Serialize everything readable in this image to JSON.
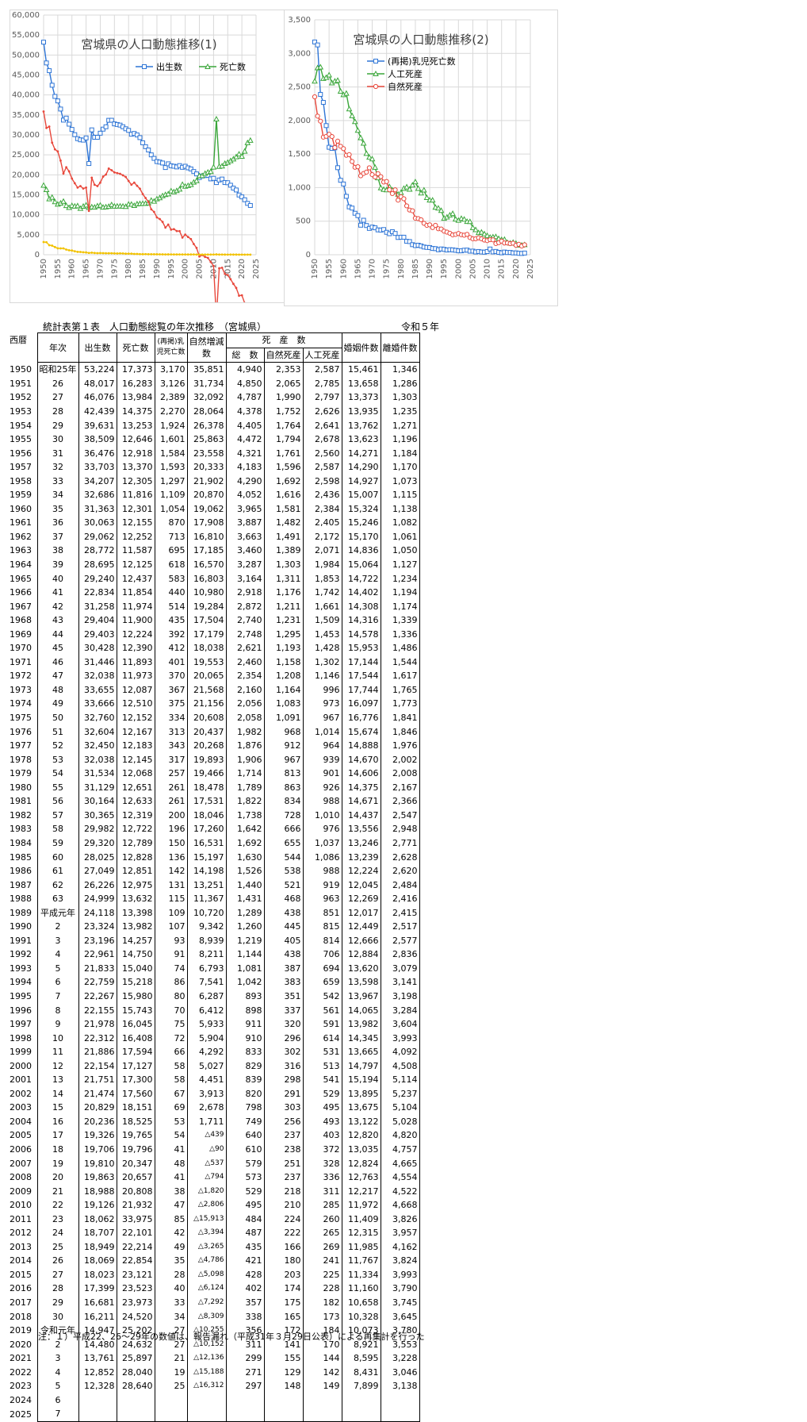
{
  "chart_data": [
    {
      "type": "line",
      "title": "宮城県の人口動態推移(1)",
      "ylim": [
        0,
        60000
      ],
      "yticks": [
        "0",
        "5,000",
        "10,000",
        "15,000",
        "20,000",
        "25,000",
        "30,000",
        "35,000",
        "40,000",
        "45,000",
        "50,000",
        "55,000",
        "60,000"
      ],
      "xlim": [
        1950,
        2025
      ],
      "xticks": [
        "1950",
        "1955",
        "1960",
        "1965",
        "1970",
        "1975",
        "1980",
        "1985",
        "1990",
        "1995",
        "2000",
        "2005",
        "2010",
        "2015",
        "2020",
        "2025"
      ],
      "grid": true,
      "legend": "top-right",
      "series": [
        {
          "name": "出生数",
          "color": "#2e75d6",
          "marker": "square",
          "field": "births"
        },
        {
          "name": "死亡数",
          "color": "#3aa63a",
          "marker": "triangle",
          "field": "deaths"
        },
        {
          "name": "",
          "color": "#e8483c",
          "marker": "none",
          "field": "natural"
        },
        {
          "name": "",
          "color": "#f2c200",
          "marker": "none",
          "field": "infant"
        }
      ]
    },
    {
      "type": "line",
      "title": "宮城県の人口動態推移(2)",
      "ylim": [
        0,
        3500
      ],
      "yticks": [
        "0",
        "500",
        "1,000",
        "1,500",
        "2,000",
        "2,500",
        "3,000",
        "3,500"
      ],
      "xlim": [
        1950,
        2025
      ],
      "xticks": [
        "1950",
        "1955",
        "1960",
        "1965",
        "1970",
        "1975",
        "1980",
        "1985",
        "1990",
        "1995",
        "2000",
        "2005",
        "2010",
        "2015",
        "2020",
        "2025"
      ],
      "grid": true,
      "legend": "top-right",
      "series": [
        {
          "name": "(再掲)乳児死亡数",
          "color": "#2e75d6",
          "marker": "square",
          "field": "infant"
        },
        {
          "name": "人工死産",
          "color": "#3aa63a",
          "marker": "triangle",
          "field": "artificial"
        },
        {
          "name": "自然死産",
          "color": "#e8483c",
          "marker": "circle",
          "field": "naturalStill"
        }
      ]
    }
  ],
  "table": {
    "title": "統計表第１表　人口動態総覧の年次推移　（宮城県）",
    "edition": "令和５年",
    "headers": {
      "year": "西暦",
      "era": "年次",
      "births": "出生数",
      "deaths": "死亡数",
      "infant_line1": "(再掲)乳",
      "infant_line2": "児死亡数",
      "natural_line1": "自然増減",
      "natural_line2": "数",
      "stillbirth": "死　産　数",
      "still_total": "総　数",
      "still_natural": "自然死産",
      "still_artificial": "人工死産",
      "marriages": "婚姻件数",
      "divorces": "離婚件数"
    },
    "rows": [
      [
        "1950",
        "昭和25年",
        "53,224",
        "17,373",
        "3,170",
        "35,851",
        "4,940",
        "2,353",
        "2,587",
        "15,461",
        "1,346"
      ],
      [
        "1951",
        "26",
        "48,017",
        "16,283",
        "3,126",
        "31,734",
        "4,850",
        "2,065",
        "2,785",
        "13,658",
        "1,286"
      ],
      [
        "1952",
        "27",
        "46,076",
        "13,984",
        "2,389",
        "32,092",
        "4,787",
        "1,990",
        "2,797",
        "13,373",
        "1,303"
      ],
      [
        "1953",
        "28",
        "42,439",
        "14,375",
        "2,270",
        "28,064",
        "4,378",
        "1,752",
        "2,626",
        "13,935",
        "1,235"
      ],
      [
        "1954",
        "29",
        "39,631",
        "13,253",
        "1,924",
        "26,378",
        "4,405",
        "1,764",
        "2,641",
        "13,762",
        "1,271"
      ],
      [
        "1955",
        "30",
        "38,509",
        "12,646",
        "1,601",
        "25,863",
        "4,472",
        "1,794",
        "2,678",
        "13,623",
        "1,196"
      ],
      [
        "1956",
        "31",
        "36,476",
        "12,918",
        "1,584",
        "23,558",
        "4,321",
        "1,761",
        "2,560",
        "14,271",
        "1,184"
      ],
      [
        "1957",
        "32",
        "33,703",
        "13,370",
        "1,593",
        "20,333",
        "4,183",
        "1,596",
        "2,587",
        "14,290",
        "1,170"
      ],
      [
        "1958",
        "33",
        "34,207",
        "12,305",
        "1,297",
        "21,902",
        "4,290",
        "1,692",
        "2,598",
        "14,927",
        "1,073"
      ],
      [
        "1959",
        "34",
        "32,686",
        "11,816",
        "1,109",
        "20,870",
        "4,052",
        "1,616",
        "2,436",
        "15,007",
        "1,115"
      ],
      [
        "1960",
        "35",
        "31,363",
        "12,301",
        "1,054",
        "19,062",
        "3,965",
        "1,581",
        "2,384",
        "15,324",
        "1,138"
      ],
      [
        "1961",
        "36",
        "30,063",
        "12,155",
        "870",
        "17,908",
        "3,887",
        "1,482",
        "2,405",
        "15,246",
        "1,082"
      ],
      [
        "1962",
        "37",
        "29,062",
        "12,252",
        "713",
        "16,810",
        "3,663",
        "1,491",
        "2,172",
        "15,170",
        "1,061"
      ],
      [
        "1963",
        "38",
        "28,772",
        "11,587",
        "695",
        "17,185",
        "3,460",
        "1,389",
        "2,071",
        "14,836",
        "1,050"
      ],
      [
        "1964",
        "39",
        "28,695",
        "12,125",
        "618",
        "16,570",
        "3,287",
        "1,303",
        "1,984",
        "15,064",
        "1,127"
      ],
      [
        "1965",
        "40",
        "29,240",
        "12,437",
        "583",
        "16,803",
        "3,164",
        "1,311",
        "1,853",
        "14,722",
        "1,234"
      ],
      [
        "1966",
        "41",
        "22,834",
        "11,854",
        "440",
        "10,980",
        "2,918",
        "1,176",
        "1,742",
        "14,402",
        "1,194"
      ],
      [
        "1967",
        "42",
        "31,258",
        "11,974",
        "514",
        "19,284",
        "2,872",
        "1,211",
        "1,661",
        "14,308",
        "1,174"
      ],
      [
        "1968",
        "43",
        "29,404",
        "11,900",
        "435",
        "17,504",
        "2,740",
        "1,231",
        "1,509",
        "14,316",
        "1,339"
      ],
      [
        "1969",
        "44",
        "29,403",
        "12,224",
        "392",
        "17,179",
        "2,748",
        "1,295",
        "1,453",
        "14,578",
        "1,336"
      ],
      [
        "1970",
        "45",
        "30,428",
        "12,390",
        "412",
        "18,038",
        "2,621",
        "1,193",
        "1,428",
        "15,953",
        "1,486"
      ],
      [
        "1971",
        "46",
        "31,446",
        "11,893",
        "401",
        "19,553",
        "2,460",
        "1,158",
        "1,302",
        "17,144",
        "1,544"
      ],
      [
        "1972",
        "47",
        "32,038",
        "11,973",
        "370",
        "20,065",
        "2,354",
        "1,208",
        "1,146",
        "17,544",
        "1,617"
      ],
      [
        "1973",
        "48",
        "33,655",
        "12,087",
        "367",
        "21,568",
        "2,160",
        "1,164",
        "996",
        "17,744",
        "1,765"
      ],
      [
        "1974",
        "49",
        "33,666",
        "12,510",
        "375",
        "21,156",
        "2,056",
        "1,083",
        "973",
        "16,097",
        "1,773"
      ],
      [
        "1975",
        "50",
        "32,760",
        "12,152",
        "334",
        "20,608",
        "2,058",
        "1,091",
        "967",
        "16,776",
        "1,841"
      ],
      [
        "1976",
        "51",
        "32,604",
        "12,167",
        "313",
        "20,437",
        "1,982",
        "968",
        "1,014",
        "15,674",
        "1,846"
      ],
      [
        "1977",
        "52",
        "32,450",
        "12,183",
        "343",
        "20,268",
        "1,876",
        "912",
        "964",
        "14,888",
        "1,976"
      ],
      [
        "1978",
        "53",
        "32,038",
        "12,145",
        "317",
        "19,893",
        "1,906",
        "967",
        "939",
        "14,670",
        "2,002"
      ],
      [
        "1979",
        "54",
        "31,534",
        "12,068",
        "257",
        "19,466",
        "1,714",
        "813",
        "901",
        "14,606",
        "2,008"
      ],
      [
        "1980",
        "55",
        "31,129",
        "12,651",
        "261",
        "18,478",
        "1,789",
        "863",
        "926",
        "14,375",
        "2,167"
      ],
      [
        "1981",
        "56",
        "30,164",
        "12,633",
        "261",
        "17,531",
        "1,822",
        "834",
        "988",
        "14,671",
        "2,366"
      ],
      [
        "1982",
        "57",
        "30,365",
        "12,319",
        "200",
        "18,046",
        "1,738",
        "728",
        "1,010",
        "14,437",
        "2,547"
      ],
      [
        "1983",
        "58",
        "29,982",
        "12,722",
        "196",
        "17,260",
        "1,642",
        "666",
        "976",
        "13,556",
        "2,948"
      ],
      [
        "1984",
        "59",
        "29,320",
        "12,789",
        "150",
        "16,531",
        "1,692",
        "655",
        "1,037",
        "13,246",
        "2,771"
      ],
      [
        "1985",
        "60",
        "28,025",
        "12,828",
        "136",
        "15,197",
        "1,630",
        "544",
        "1,086",
        "13,239",
        "2,628"
      ],
      [
        "1986",
        "61",
        "27,049",
        "12,851",
        "142",
        "14,198",
        "1,526",
        "538",
        "988",
        "12,224",
        "2,620"
      ],
      [
        "1987",
        "62",
        "26,226",
        "12,975",
        "131",
        "13,251",
        "1,440",
        "521",
        "919",
        "12,045",
        "2,484"
      ],
      [
        "1988",
        "63",
        "24,999",
        "13,632",
        "115",
        "11,367",
        "1,431",
        "468",
        "963",
        "12,269",
        "2,416"
      ],
      [
        "1989",
        "平成元年",
        "24,118",
        "13,398",
        "109",
        "10,720",
        "1,289",
        "438",
        "851",
        "12,017",
        "2,415"
      ],
      [
        "1990",
        "2",
        "23,324",
        "13,982",
        "107",
        "9,342",
        "1,260",
        "445",
        "815",
        "12,449",
        "2,517"
      ],
      [
        "1991",
        "3",
        "23,196",
        "14,257",
        "93",
        "8,939",
        "1,219",
        "405",
        "814",
        "12,666",
        "2,577"
      ],
      [
        "1992",
        "4",
        "22,961",
        "14,750",
        "91",
        "8,211",
        "1,144",
        "438",
        "706",
        "12,884",
        "2,836"
      ],
      [
        "1993",
        "5",
        "21,833",
        "15,040",
        "74",
        "6,793",
        "1,081",
        "387",
        "694",
        "13,620",
        "3,079"
      ],
      [
        "1994",
        "6",
        "22,759",
        "15,218",
        "86",
        "7,541",
        "1,042",
        "383",
        "659",
        "13,598",
        "3,141"
      ],
      [
        "1995",
        "7",
        "22,267",
        "15,980",
        "80",
        "6,287",
        "893",
        "351",
        "542",
        "13,967",
        "3,198"
      ],
      [
        "1996",
        "8",
        "22,155",
        "15,743",
        "70",
        "6,412",
        "898",
        "337",
        "561",
        "14,065",
        "3,284"
      ],
      [
        "1997",
        "9",
        "21,978",
        "16,045",
        "75",
        "5,933",
        "911",
        "320",
        "591",
        "13,982",
        "3,604"
      ],
      [
        "1998",
        "10",
        "22,312",
        "16,408",
        "72",
        "5,904",
        "910",
        "296",
        "614",
        "14,345",
        "3,993"
      ],
      [
        "1999",
        "11",
        "21,886",
        "17,594",
        "66",
        "4,292",
        "833",
        "302",
        "531",
        "13,665",
        "4,092"
      ],
      [
        "2000",
        "12",
        "22,154",
        "17,127",
        "58",
        "5,027",
        "829",
        "316",
        "513",
        "14,797",
        "4,508"
      ],
      [
        "2001",
        "13",
        "21,751",
        "17,300",
        "58",
        "4,451",
        "839",
        "298",
        "541",
        "15,194",
        "5,114"
      ],
      [
        "2002",
        "14",
        "21,474",
        "17,560",
        "67",
        "3,913",
        "820",
        "291",
        "529",
        "13,895",
        "5,237"
      ],
      [
        "2003",
        "15",
        "20,829",
        "18,151",
        "69",
        "2,678",
        "798",
        "303",
        "495",
        "13,675",
        "5,104"
      ],
      [
        "2004",
        "16",
        "20,236",
        "18,525",
        "53",
        "1,711",
        "749",
        "256",
        "493",
        "13,122",
        "5,028"
      ],
      [
        "2005",
        "17",
        "19,326",
        "19,765",
        "54",
        "△439",
        "640",
        "237",
        "403",
        "12,820",
        "4,820"
      ],
      [
        "2006",
        "18",
        "19,706",
        "19,796",
        "41",
        "△90",
        "610",
        "238",
        "372",
        "13,035",
        "4,757"
      ],
      [
        "2007",
        "19",
        "19,810",
        "20,347",
        "48",
        "△537",
        "579",
        "251",
        "328",
        "12,824",
        "4,665"
      ],
      [
        "2008",
        "20",
        "19,863",
        "20,657",
        "41",
        "△794",
        "573",
        "237",
        "336",
        "12,763",
        "4,554"
      ],
      [
        "2009",
        "21",
        "18,988",
        "20,808",
        "38",
        "△1,820",
        "529",
        "218",
        "311",
        "12,217",
        "4,522"
      ],
      [
        "2010",
        "22",
        "19,126",
        "21,932",
        "47",
        "△2,806",
        "495",
        "210",
        "285",
        "11,972",
        "4,668"
      ],
      [
        "2011",
        "23",
        "18,062",
        "33,975",
        "85",
        "△15,913",
        "484",
        "224",
        "260",
        "11,409",
        "3,826"
      ],
      [
        "2012",
        "24",
        "18,707",
        "22,101",
        "42",
        "△3,394",
        "487",
        "222",
        "265",
        "12,315",
        "3,957"
      ],
      [
        "2013",
        "25",
        "18,949",
        "22,214",
        "49",
        "△3,265",
        "435",
        "166",
        "269",
        "11,985",
        "4,162"
      ],
      [
        "2014",
        "26",
        "18,069",
        "22,854",
        "35",
        "△4,786",
        "421",
        "180",
        "241",
        "11,767",
        "3,824"
      ],
      [
        "2015",
        "27",
        "18,023",
        "23,121",
        "28",
        "△5,098",
        "428",
        "203",
        "225",
        "11,334",
        "3,993"
      ],
      [
        "2016",
        "28",
        "17,399",
        "23,523",
        "40",
        "△6,124",
        "402",
        "174",
        "228",
        "11,160",
        "3,790"
      ],
      [
        "2017",
        "29",
        "16,681",
        "23,973",
        "33",
        "△7,292",
        "357",
        "175",
        "182",
        "10,658",
        "3,745"
      ],
      [
        "2018",
        "30",
        "16,211",
        "24,520",
        "34",
        "△8,309",
        "338",
        "165",
        "173",
        "10,328",
        "3,645"
      ],
      [
        "2019",
        "令和元年",
        "14,947",
        "25,202",
        "27",
        "△10,255",
        "356",
        "172",
        "184",
        "10,073",
        "3,780"
      ],
      [
        "2020",
        "2",
        "14,480",
        "24,632",
        "27",
        "△10,152",
        "311",
        "141",
        "170",
        "8,921",
        "3,553"
      ],
      [
        "2021",
        "3",
        "13,761",
        "25,897",
        "21",
        "△12,136",
        "299",
        "155",
        "144",
        "8,595",
        "3,228"
      ],
      [
        "2022",
        "4",
        "12,852",
        "28,040",
        "19",
        "△15,188",
        "271",
        "129",
        "142",
        "8,431",
        "3,046"
      ],
      [
        "2023",
        "5",
        "12,328",
        "28,640",
        "25",
        "△16,312",
        "297",
        "148",
        "149",
        "7,899",
        "3,138"
      ],
      [
        "2024",
        "6",
        "",
        "",
        "",
        "",
        "",
        "",
        "",
        "",
        ""
      ],
      [
        "2025",
        "7",
        "",
        "",
        "",
        "",
        "",
        "",
        "",
        "",
        ""
      ]
    ],
    "note": "注：１）平成22、26～29年の数値は、報告漏れ（平成31年３月29日公表）による再集計を行った"
  }
}
